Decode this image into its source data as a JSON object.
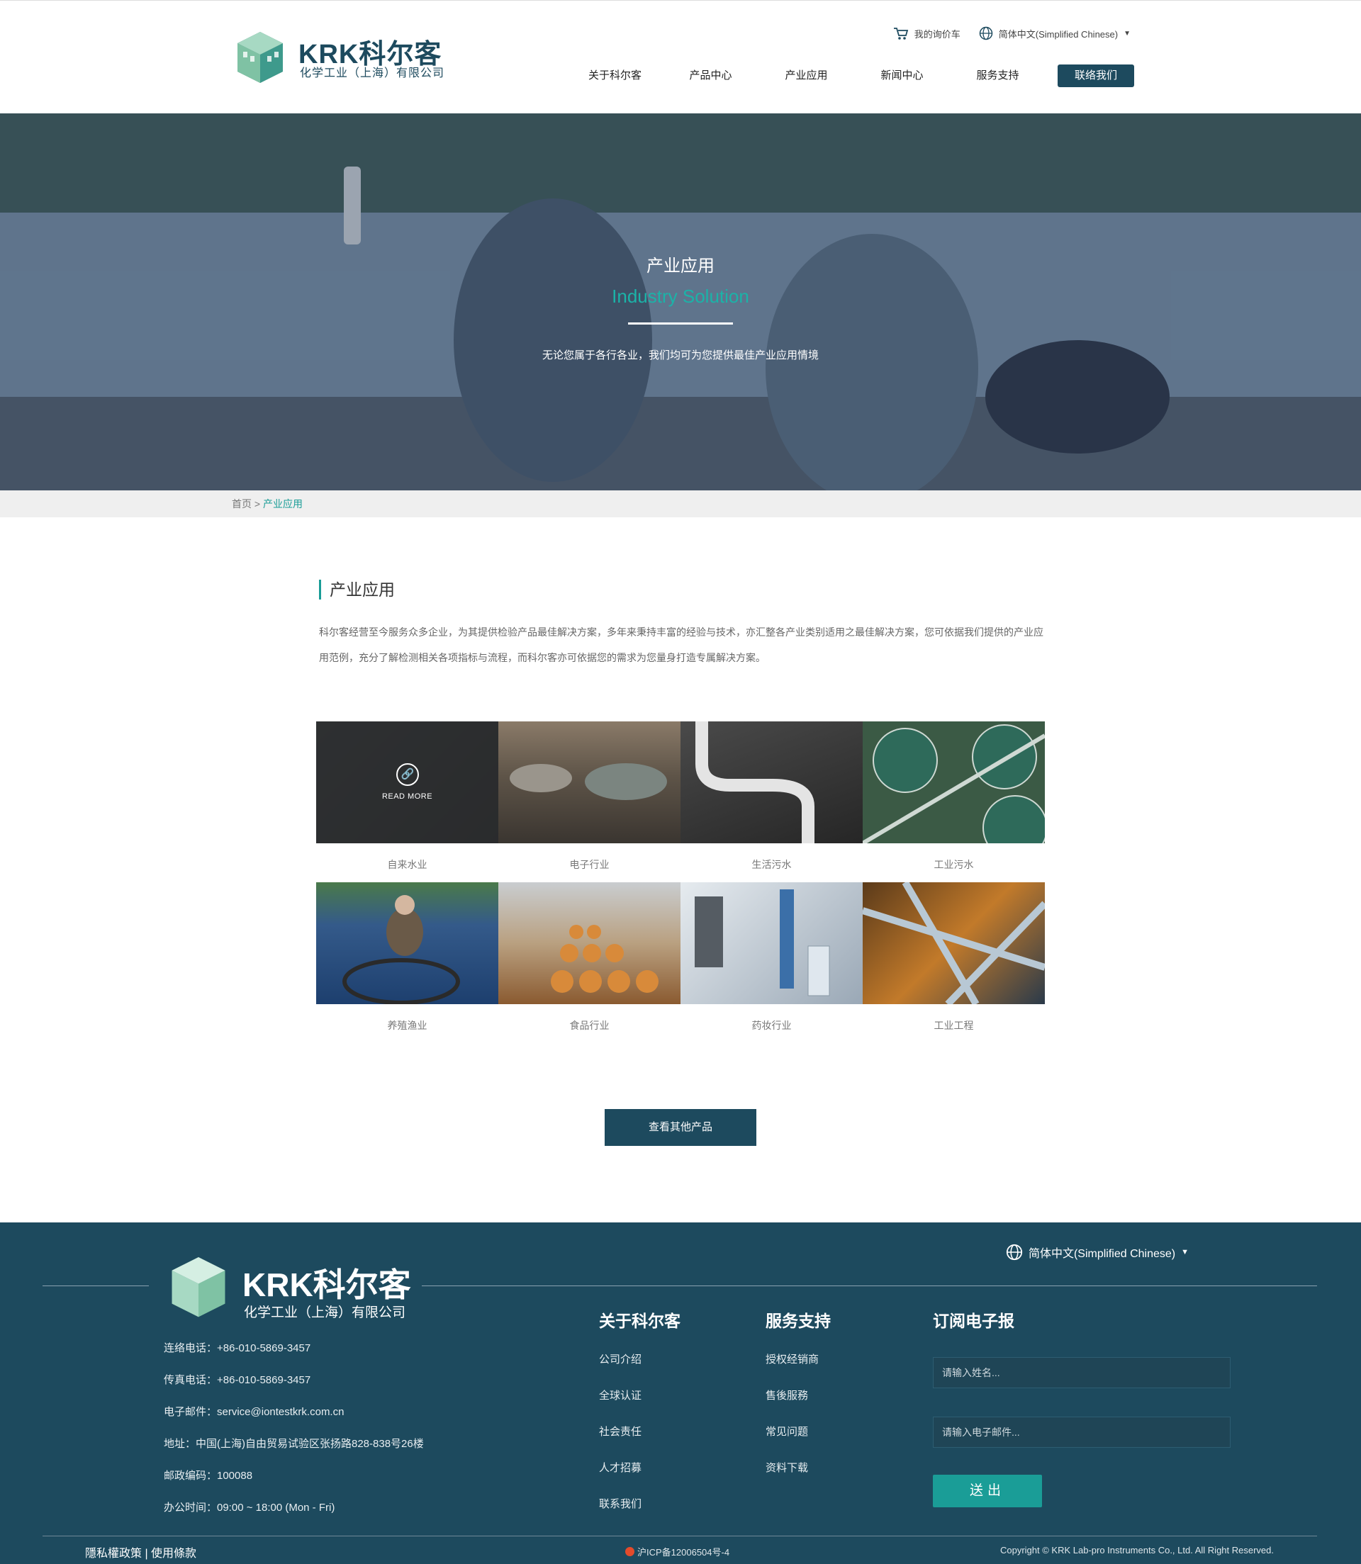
{
  "header": {
    "brand": "KRK科尔客",
    "brand_sub": "化学工业（上海）有限公司",
    "cart_label": "我的询价车",
    "lang_label": "简体中文(Simplified Chinese)",
    "nav": [
      "关于科尔客",
      "产品中心",
      "产业应用",
      "新闻中心",
      "服务支持"
    ],
    "contact_label": "联络我们"
  },
  "hero": {
    "title": "产业应用",
    "subtitle_en": "Industry Solution",
    "tagline": "无论您属于各行各业，我们均可为您提供最佳产业应用情境"
  },
  "breadcrumb": {
    "home": "首页",
    "sep": ">",
    "current": "产业应用"
  },
  "section": {
    "title": "产业应用",
    "desc": "科尔客经营至今服务众多企业，为其提供检验产品最佳解决方案，多年来秉持丰富的经验与技术，亦汇整各产业类别适用之最佳解决方案，您可依据我们提供的产业应用范例，充分了解检测相关各项指标与流程，而科尔客亦可依据您的需求为您量身打造专属解决方案。"
  },
  "industries": [
    {
      "label": "自来水业"
    },
    {
      "label": "电子行业"
    },
    {
      "label": "生活污水"
    },
    {
      "label": "工业污水"
    },
    {
      "label": "养殖渔业"
    },
    {
      "label": "食品行业"
    },
    {
      "label": "药妆行业"
    },
    {
      "label": "工业工程"
    }
  ],
  "read_more": "READ MORE",
  "more_button": "查看其他产品",
  "footer": {
    "brand": "KRK科尔客",
    "brand_sub": "化学工业（上海）有限公司",
    "lang_label": "简体中文(Simplified Chinese)",
    "info": [
      "连络电话：+86-010-5869-3457",
      "传真电话：+86-010-5869-3457",
      "电子邮件：service@iontestkrk.com.cn",
      "地址：中国(上海)自由贸易试验区张扬路828-838号26楼",
      "邮政编码：100088",
      "办公时间：09:00 ~ 18:00 (Mon - Fri)"
    ],
    "about": {
      "title": "关于科尔客",
      "links": [
        "公司介绍",
        "全球认证",
        "社会责任",
        "人才招募",
        "联系我们"
      ]
    },
    "service": {
      "title": "服务支持",
      "links": [
        "授权经销商",
        "售後服務",
        "常见问题",
        "资料下载"
      ]
    },
    "subscribe": {
      "title": "订阅电子报",
      "name_placeholder": "请输入姓名...",
      "email_placeholder": "请输入电子邮件...",
      "send_label": "送出"
    },
    "privacy": "隱私權政策 | 使用條款",
    "icp": "沪ICP备12006504号-4",
    "copyright": "Copyright © KRK Lab-pro Instruments Co., Ltd. All Right Reserved."
  }
}
